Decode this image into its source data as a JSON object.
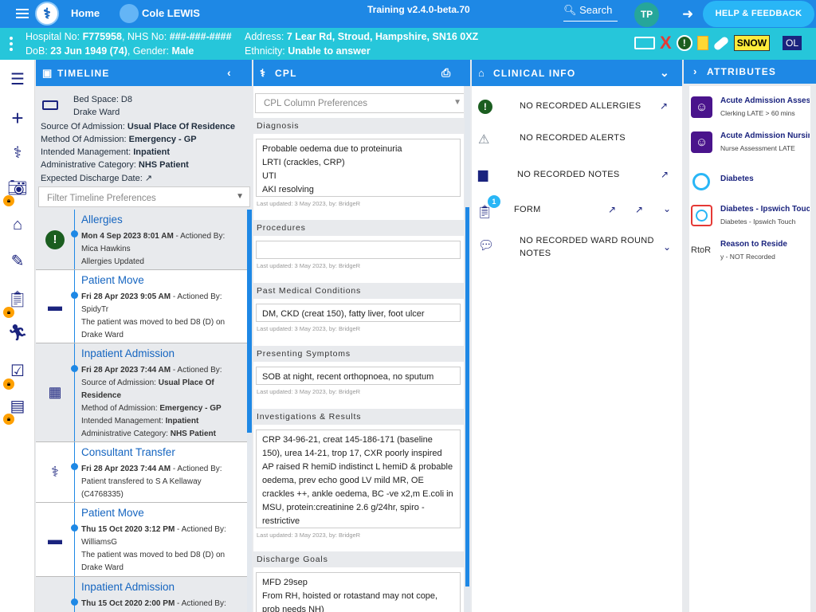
{
  "topbar": {
    "home_label": "Home",
    "patient_name": "Cole LEWIS",
    "environment": "Training v2.4.0-beta.70",
    "search_label": "Search",
    "user_initials": "TP",
    "help_label": "HELP & FEEDBACK"
  },
  "patient_banner": {
    "hospital_no_label": "Hospital No:",
    "hospital_no": "F775958",
    "nhs_no_label": "NHS No:",
    "nhs_no": "###-###-####",
    "address_label": "Address:",
    "address": "7 Lear Rd, Stroud, Hampshire, SN16 0XZ",
    "dob_label": "DoB:",
    "dob": "23 Jun 1949 (74)",
    "gender_label": "Gender:",
    "gender": "Male",
    "ethnicity_label": "Ethnicity:",
    "ethnicity": "Unable to answer",
    "flags": {
      "snow": "SNOW",
      "ol": "OL",
      "x": "X",
      "alert": "!"
    }
  },
  "panels": {
    "timeline_title": "TIMELINE",
    "cpl_title": "CPL",
    "clinical_title": "CLINICAL INFO",
    "attributes_title": "ATTRIBUTES"
  },
  "timeline_header": {
    "bed_space": "Bed Space: D8",
    "ward": "Drake Ward",
    "source_label": "Source Of Admission:",
    "source": "Usual Place Of Residence",
    "method_label": "Method Of Admission:",
    "method": "Emergency - GP",
    "mgmt_label": "Intended Management:",
    "mgmt": "Inpatient",
    "category_label": "Administrative Category:",
    "category": "NHS Patient",
    "discharge_label": "Expected Discharge Date:",
    "filter_placeholder": "Filter Timeline Preferences"
  },
  "timeline": [
    {
      "title": "Allergies",
      "date": "Mon 4 Sep 2023 8:01 AM",
      "actioned_label": " - Actioned By:",
      "by": "Mica Hawkins",
      "line1": "Allergies Updated"
    },
    {
      "title": "Patient Move",
      "date": "Fri 28 Apr 2023 9:05 AM",
      "actioned_label": " - Actioned By:",
      "by": "SpidyTr",
      "line1": "The patient was moved to bed D8 (D) on",
      "line2": "Drake Ward"
    },
    {
      "title": "Inpatient Admission",
      "date": "Fri 28 Apr 2023 7:44 AM",
      "actioned_label": " - Actioned By:",
      "src_label": "Source of Admission:",
      "src": "Usual Place Of",
      "src2": "Residence",
      "mth_label": "Method of Admission:",
      "mth": "Emergency - GP",
      "mg_label": "Intended Management:",
      "mg": "Inpatient",
      "cat_label": "Administrative Category:",
      "cat": "NHS Patient"
    },
    {
      "title": "Consultant Transfer",
      "date": "Fri 28 Apr 2023 7:44 AM",
      "actioned_label": " - Actioned By:",
      "line1": "Patient transfered to S A Kellaway",
      "line2": "(C4768335)"
    },
    {
      "title": "Patient Move",
      "date": "Thu 15 Oct 2020 3:12 PM",
      "actioned_label": " - Actioned By:",
      "by": "WilliamsG",
      "line1": "The patient was moved to bed D8 (D) on",
      "line2": "Drake Ward"
    },
    {
      "title": "Inpatient Admission",
      "date": "Thu 15 Oct 2020 2:00 PM",
      "actioned_label": " - Actioned By:"
    }
  ],
  "cpl": {
    "pref_placeholder": "CPL Column Preferences",
    "sections": [
      {
        "label": "Diagnosis",
        "text": "Probable oedema due to proteinuria\nLRTI (crackles, CRP)\nUTI\nAKI resolving",
        "updated": "Last updated: 3 May 2023, by: BridgeR"
      },
      {
        "label": "Procedures",
        "text": "",
        "updated": "Last updated: 3 May 2023, by: BridgeR"
      },
      {
        "label": "Past Medical Conditions",
        "text": "DM, CKD (creat 150), fatty liver, foot ulcer",
        "updated": "Last updated: 3 May 2023, by: BridgeR"
      },
      {
        "label": "Presenting Symptoms",
        "text": "SOB at night, recent orthopnoea, no sputum",
        "updated": "Last updated: 3 May 2023, by: BridgeR"
      },
      {
        "label": "Investigations & Results",
        "text": "CRP 34-96-21, creat 145-186-171 (baseline 150), urea 14-21, trop 17, CXR poorly inspired AP raised R hemiD indistinct L hemiD & probable oedema, prev echo good LV mild MR, OE crackles ++, ankle oedema, BC -ve x2,m E.coli in MSU, protein:creatinine 2.6 g/24hr, spiro - restrictive",
        "updated": "Last updated: 3 May 2023, by: BridgeR"
      },
      {
        "label": "Discharge Goals",
        "text": "MFD 29sep\nFrom RH, hoisted or rotastand may not cope, prob needs NH)",
        "updated": ""
      }
    ]
  },
  "clinical_info": {
    "allergies": "NO RECORDED ALLERGIES",
    "alerts": "NO RECORDED ALERTS",
    "notes": "NO RECORDED NOTES",
    "form": "FORM",
    "form_count": "1",
    "ward_round_1": "NO RECORDED WARD ROUND",
    "ward_round_2": "NOTES"
  },
  "attributes": [
    {
      "title": "Acute Admission Assessment",
      "sub": "Clerking LATE > 60 mins"
    },
    {
      "title": "Acute Admission Nursing",
      "sub": "Nurse Assessment LATE"
    },
    {
      "title": "Diabetes",
      "sub": ""
    },
    {
      "title": "Diabetes - Ipswich Touch",
      "sub": "Diabetes - Ipswich Touch"
    },
    {
      "title": "Reason to Reside",
      "sub": "y - NOT Recorded",
      "icon_text": "RtoR"
    }
  ]
}
